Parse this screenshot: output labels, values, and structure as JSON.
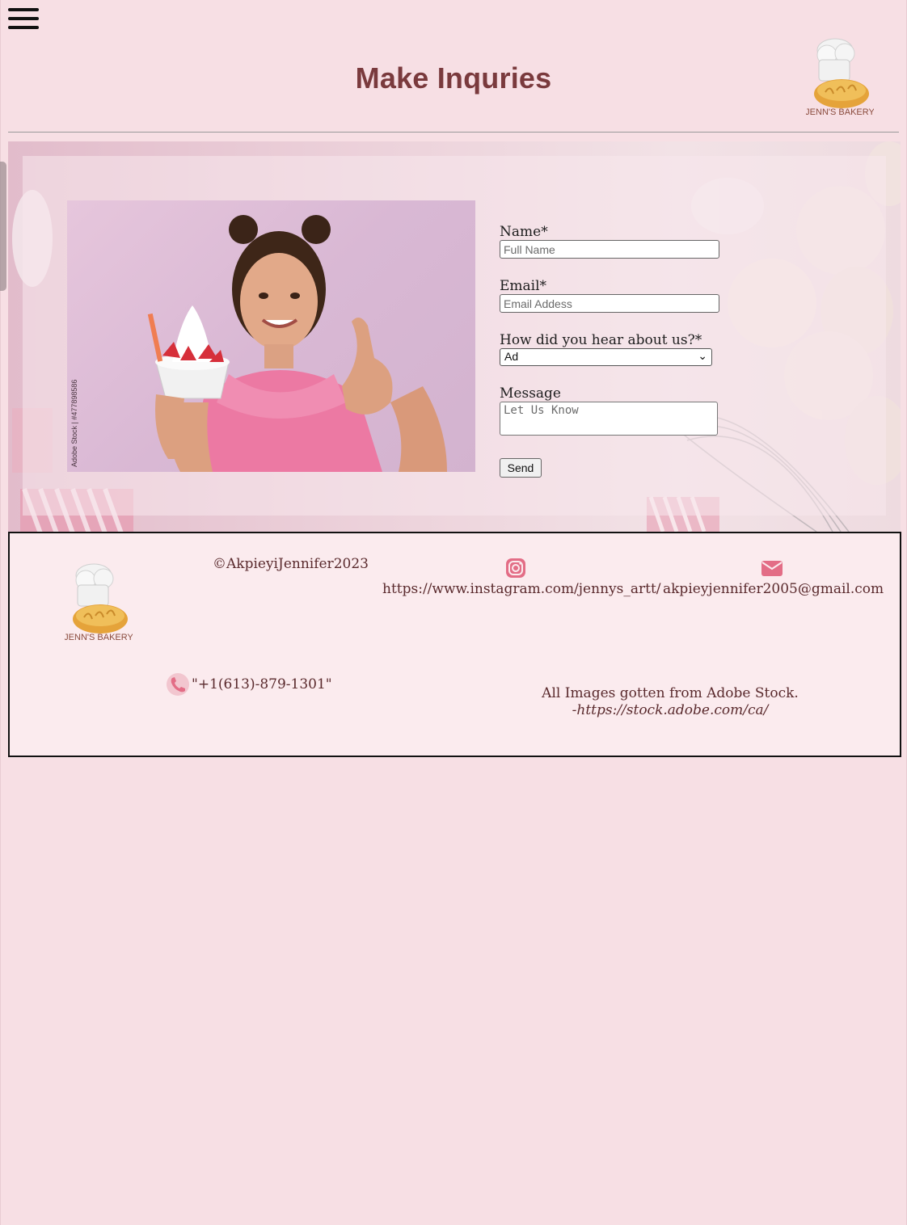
{
  "page": {
    "title": "Make Inquries"
  },
  "logo": {
    "text": "JENN'S BAKERY"
  },
  "nav": {
    "menu_icon": "hamburger-menu-icon"
  },
  "form": {
    "name_label": "Name*",
    "name_placeholder": "Full Name",
    "email_label": "Email*",
    "email_placeholder": "Email Addess",
    "hear_label": "How did you hear about us?*",
    "hear_selected": "Ad",
    "message_label": "Message",
    "message_placeholder": "Let Us Know",
    "send_label": "Send"
  },
  "photo": {
    "watermark": "Adobe Stock | #477898586"
  },
  "footer": {
    "copyright": "©AkpieyiJennifer2023",
    "instagram_url": "https://www.instagram.com/jennys_artt/",
    "email": "akpieyjennifer2005@gmail.com",
    "phone": "\"+1(613)-879-1301\"",
    "credits_line1": "All Images gotten from Adobe Stock.",
    "credits_line2": "-https://stock.adobe.com/ca/"
  },
  "colors": {
    "background": "#f7dfe4",
    "title": "#7a3a3d",
    "icon_pink": "#e36d86",
    "footer_text": "#5a2a2d"
  }
}
